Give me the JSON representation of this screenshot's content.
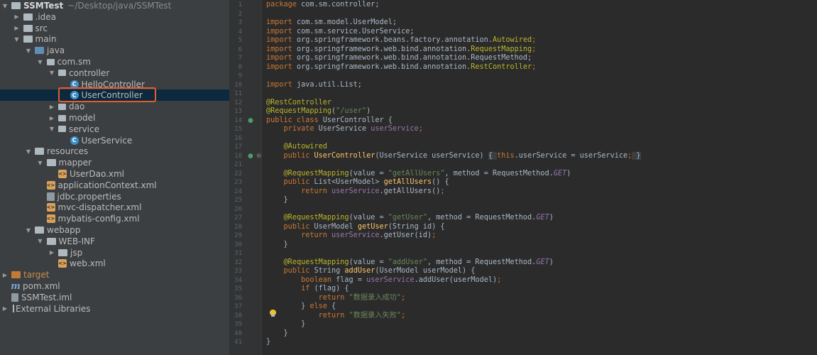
{
  "project_tree": {
    "items": [
      {
        "label": "SSMTest",
        "path": "~/Desktop/java/SSMTest",
        "depth": 0,
        "arrow": "down",
        "icon": "folder",
        "bold": true
      },
      {
        "label": ".idea",
        "depth": 1,
        "arrow": "right",
        "icon": "folder"
      },
      {
        "label": "src",
        "depth": 1,
        "arrow": "right",
        "icon": "folder"
      },
      {
        "label": "main",
        "depth": 1,
        "arrow": "down",
        "icon": "folder"
      },
      {
        "label": "java",
        "depth": 2,
        "arrow": "down",
        "icon": "folder-blue"
      },
      {
        "label": "com.sm",
        "depth": 3,
        "arrow": "down",
        "icon": "package"
      },
      {
        "label": "controller",
        "depth": 4,
        "arrow": "down",
        "icon": "package"
      },
      {
        "label": "HelloController",
        "depth": 5,
        "arrow": "none",
        "icon": "class"
      },
      {
        "label": "UserController",
        "depth": 5,
        "arrow": "none",
        "icon": "class",
        "selected": true
      },
      {
        "label": "dao",
        "depth": 4,
        "arrow": "right",
        "icon": "package"
      },
      {
        "label": "model",
        "depth": 4,
        "arrow": "right",
        "icon": "package"
      },
      {
        "label": "service",
        "depth": 4,
        "arrow": "down",
        "icon": "package"
      },
      {
        "label": "UserService",
        "depth": 5,
        "arrow": "none",
        "icon": "class"
      },
      {
        "label": "resources",
        "depth": 2,
        "arrow": "down",
        "icon": "folder-res"
      },
      {
        "label": "mapper",
        "depth": 3,
        "arrow": "down",
        "icon": "folder"
      },
      {
        "label": "UserDao.xml",
        "depth": 4,
        "arrow": "none",
        "icon": "xml"
      },
      {
        "label": "applicationContext.xml",
        "depth": 3,
        "arrow": "none",
        "icon": "xml"
      },
      {
        "label": "jdbc.properties",
        "depth": 3,
        "arrow": "none",
        "icon": "properties"
      },
      {
        "label": "mvc-dispatcher.xml",
        "depth": 3,
        "arrow": "none",
        "icon": "xml"
      },
      {
        "label": "mybatis-config.xml",
        "depth": 3,
        "arrow": "none",
        "icon": "xml"
      },
      {
        "label": "webapp",
        "depth": 2,
        "arrow": "down",
        "icon": "folder"
      },
      {
        "label": "WEB-INF",
        "depth": 3,
        "arrow": "down",
        "icon": "folder"
      },
      {
        "label": "jsp",
        "depth": 4,
        "arrow": "right",
        "icon": "folder"
      },
      {
        "label": "web.xml",
        "depth": 4,
        "arrow": "none",
        "icon": "xml"
      },
      {
        "label": "target",
        "depth": 0,
        "arrow": "right",
        "icon": "folder-orange",
        "orange": true
      },
      {
        "label": "pom.xml",
        "depth": 0,
        "arrow": "none",
        "icon": "maven"
      },
      {
        "label": "SSMTest.iml",
        "depth": 0,
        "arrow": "none",
        "icon": "iml"
      },
      {
        "label": "External Libraries",
        "depth": 0,
        "arrow": "right",
        "icon": "library"
      }
    ]
  },
  "editor": {
    "lines": [
      {
        "n": 1,
        "tokens": [
          [
            "kw",
            "package "
          ],
          [
            "",
            "com.sm.controller;"
          ]
        ]
      },
      {
        "n": 2,
        "tokens": []
      },
      {
        "n": 3,
        "tokens": [
          [
            "kw",
            "import "
          ],
          [
            "",
            "com.sm.model.UserModel;"
          ]
        ]
      },
      {
        "n": 4,
        "tokens": [
          [
            "kw",
            "import "
          ],
          [
            "",
            "com.sm.service.UserService;"
          ]
        ]
      },
      {
        "n": 5,
        "tokens": [
          [
            "kw",
            "import "
          ],
          [
            "",
            "org.springframework.beans.factory.annotation."
          ],
          [
            "an",
            "Autowired"
          ],
          [
            "kw",
            ";"
          ]
        ]
      },
      {
        "n": 6,
        "tokens": [
          [
            "kw",
            "import "
          ],
          [
            "",
            "org.springframework.web.bind.annotation."
          ],
          [
            "an",
            "RequestMapping"
          ],
          [
            "kw",
            ";"
          ]
        ]
      },
      {
        "n": 7,
        "tokens": [
          [
            "kw",
            "import "
          ],
          [
            "",
            "org.springframework.web.bind.annotation.RequestMethod;"
          ]
        ]
      },
      {
        "n": 8,
        "tokens": [
          [
            "kw",
            "import "
          ],
          [
            "",
            "org.springframework.web.bind.annotation."
          ],
          [
            "an",
            "RestController"
          ],
          [
            "kw",
            ";"
          ]
        ]
      },
      {
        "n": 9,
        "tokens": []
      },
      {
        "n": 10,
        "tokens": [
          [
            "kw",
            "import "
          ],
          [
            "",
            "java.util.List;"
          ]
        ]
      },
      {
        "n": 11,
        "tokens": []
      },
      {
        "n": 12,
        "tokens": [
          [
            "an",
            "@RestController"
          ]
        ]
      },
      {
        "n": 13,
        "tokens": [
          [
            "an",
            "@RequestMapping"
          ],
          [
            "",
            "("
          ],
          [
            "st",
            "\"/user\""
          ],
          [
            "",
            ")"
          ]
        ]
      },
      {
        "n": 14,
        "tokens": [
          [
            "kw",
            "public class "
          ],
          [
            "",
            "UserController {"
          ]
        ]
      },
      {
        "n": 15,
        "tokens": [
          [
            "",
            "    "
          ],
          [
            "kw",
            "private "
          ],
          [
            "",
            "UserService "
          ],
          [
            "fd",
            "userService"
          ],
          [
            "kw",
            ";"
          ]
        ]
      },
      {
        "n": 16,
        "tokens": []
      },
      {
        "n": 17,
        "tokens": [
          [
            "",
            "    "
          ],
          [
            "an",
            "@Autowired"
          ]
        ]
      },
      {
        "n": 18,
        "tokens": [
          [
            "",
            "    "
          ],
          [
            "kw",
            "public "
          ],
          [
            "fn",
            "UserController"
          ],
          [
            "",
            "(UserService userService) "
          ],
          [
            "fold",
            "{ "
          ],
          [
            "kw",
            "this"
          ],
          [
            "",
            ".userService = userService"
          ],
          [
            "kw",
            ";"
          ],
          [
            "fold",
            " }"
          ]
        ]
      },
      {
        "n": 21,
        "tokens": []
      },
      {
        "n": 22,
        "tokens": [
          [
            "",
            "    "
          ],
          [
            "an",
            "@RequestMapping"
          ],
          [
            "",
            "(value = "
          ],
          [
            "st",
            "\"getAllUsers\""
          ],
          [
            "",
            ", method = RequestMethod."
          ],
          [
            "it",
            "GET"
          ],
          [
            "",
            ")"
          ]
        ]
      },
      {
        "n": 23,
        "tokens": [
          [
            "",
            "    "
          ],
          [
            "kw",
            "public "
          ],
          [
            "",
            "List<UserModel> "
          ],
          [
            "fn",
            "getAllUsers"
          ],
          [
            "",
            "() {"
          ]
        ]
      },
      {
        "n": 24,
        "tokens": [
          [
            "",
            "        "
          ],
          [
            "kw",
            "return "
          ],
          [
            "fd",
            "userService"
          ],
          [
            "",
            ".getAllUsers()"
          ],
          [
            "kw",
            ";"
          ]
        ]
      },
      {
        "n": 25,
        "tokens": [
          [
            "",
            "    }"
          ]
        ]
      },
      {
        "n": 26,
        "tokens": []
      },
      {
        "n": 27,
        "tokens": [
          [
            "",
            "    "
          ],
          [
            "an",
            "@RequestMapping"
          ],
          [
            "",
            "(value = "
          ],
          [
            "st",
            "\"getUser\""
          ],
          [
            "",
            ", method = RequestMethod."
          ],
          [
            "it",
            "GET"
          ],
          [
            "",
            ")"
          ]
        ]
      },
      {
        "n": 28,
        "tokens": [
          [
            "",
            "    "
          ],
          [
            "kw",
            "public "
          ],
          [
            "",
            "UserModel "
          ],
          [
            "fn",
            "getUser"
          ],
          [
            "",
            "(String id) {"
          ]
        ]
      },
      {
        "n": 29,
        "tokens": [
          [
            "",
            "        "
          ],
          [
            "kw",
            "return "
          ],
          [
            "fd",
            "userService"
          ],
          [
            "",
            ".getUser(id)"
          ],
          [
            "kw",
            ";"
          ]
        ]
      },
      {
        "n": 30,
        "tokens": [
          [
            "",
            "    }"
          ]
        ]
      },
      {
        "n": 31,
        "tokens": []
      },
      {
        "n": 32,
        "tokens": [
          [
            "",
            "    "
          ],
          [
            "an",
            "@RequestMapping"
          ],
          [
            "",
            "(value = "
          ],
          [
            "st",
            "\"addUser\""
          ],
          [
            "",
            ", method = RequestMethod."
          ],
          [
            "it",
            "GET"
          ],
          [
            "",
            ")"
          ]
        ]
      },
      {
        "n": 33,
        "tokens": [
          [
            "",
            "    "
          ],
          [
            "kw",
            "public "
          ],
          [
            "",
            "String "
          ],
          [
            "fn",
            "addUser"
          ],
          [
            "",
            "(UserModel userModel) {"
          ]
        ]
      },
      {
        "n": 34,
        "tokens": [
          [
            "",
            "        "
          ],
          [
            "kw",
            "boolean "
          ],
          [
            "",
            "flag = "
          ],
          [
            "fd",
            "userService"
          ],
          [
            "",
            ".addUser(userModel)"
          ],
          [
            "kw",
            ";"
          ]
        ]
      },
      {
        "n": 35,
        "tokens": [
          [
            "",
            "        "
          ],
          [
            "kw",
            "if "
          ],
          [
            "",
            "(flag) {"
          ]
        ]
      },
      {
        "n": 36,
        "tokens": [
          [
            "",
            "            "
          ],
          [
            "kw",
            "return "
          ],
          [
            "st",
            "\"数据录入成功\""
          ],
          [
            "kw",
            ";"
          ]
        ]
      },
      {
        "n": 37,
        "tokens": [
          [
            "",
            "        } "
          ],
          [
            "kw",
            "else "
          ],
          [
            "",
            "{"
          ]
        ]
      },
      {
        "n": 38,
        "tokens": [
          [
            "",
            "            "
          ],
          [
            "kw",
            "return "
          ],
          [
            "st",
            "\"数据录入失败\""
          ],
          [
            "kw",
            ";"
          ]
        ]
      },
      {
        "n": 39,
        "tokens": [
          [
            "",
            "        }"
          ]
        ]
      },
      {
        "n": 40,
        "tokens": [
          [
            "",
            "    }"
          ]
        ]
      },
      {
        "n": 41,
        "tokens": [
          [
            "",
            "}"
          ]
        ]
      }
    ]
  },
  "colors": {
    "keyword": "#cc7832",
    "annotation": "#bbb529",
    "string": "#6a8759",
    "field": "#9876aa",
    "method": "#ffc66d",
    "selection_box": "#e25c2e"
  }
}
